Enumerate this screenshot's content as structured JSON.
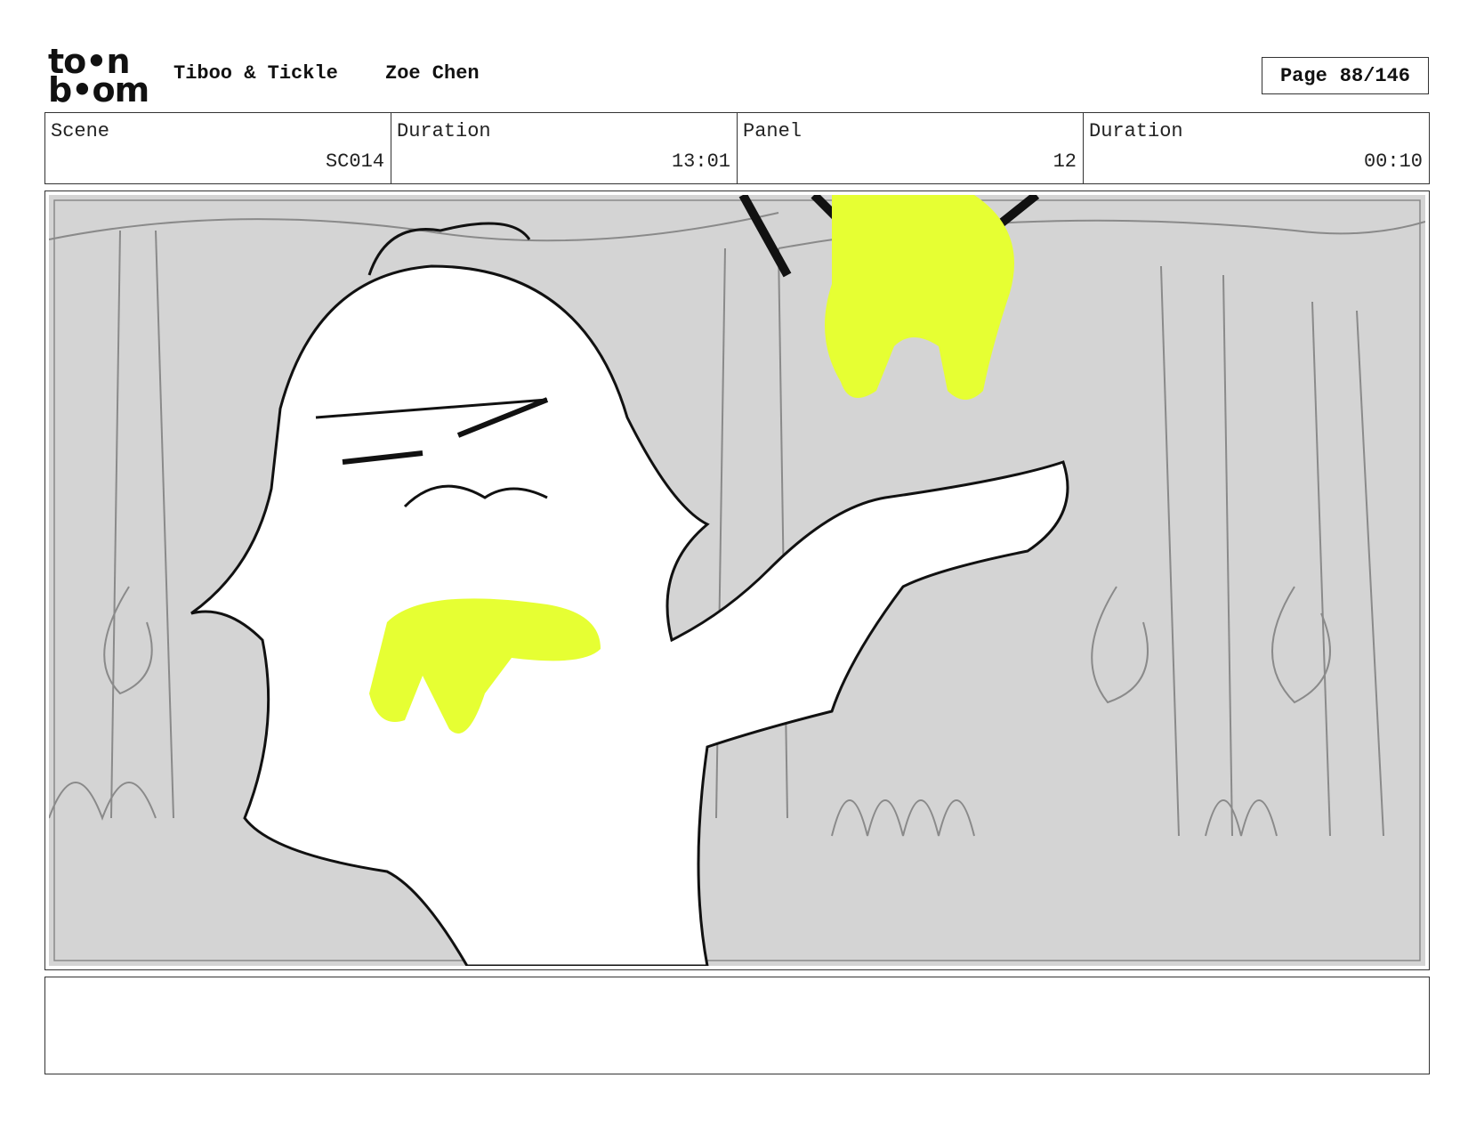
{
  "header": {
    "logo": {
      "line1": "to•n",
      "line2": "b•om",
      "name": "toonboom-logo"
    },
    "project_title": "Tiboo & Tickle",
    "author": "Zoe Chen",
    "page_label": "Page",
    "page_value": "88/146"
  },
  "info": {
    "scene_label": "Scene",
    "scene_value": "SC014",
    "scene_duration_label": "Duration",
    "scene_duration_value": "13:01",
    "panel_label": "Panel",
    "panel_value": "12",
    "panel_duration_label": "Duration",
    "panel_duration_value": "00:10"
  },
  "panel_image": {
    "colors": {
      "background": "#d4d4d4",
      "slime": "#e6ff33",
      "line": "#111111",
      "sketch": "#8a8a8a"
    }
  },
  "notes": {
    "text": ""
  }
}
